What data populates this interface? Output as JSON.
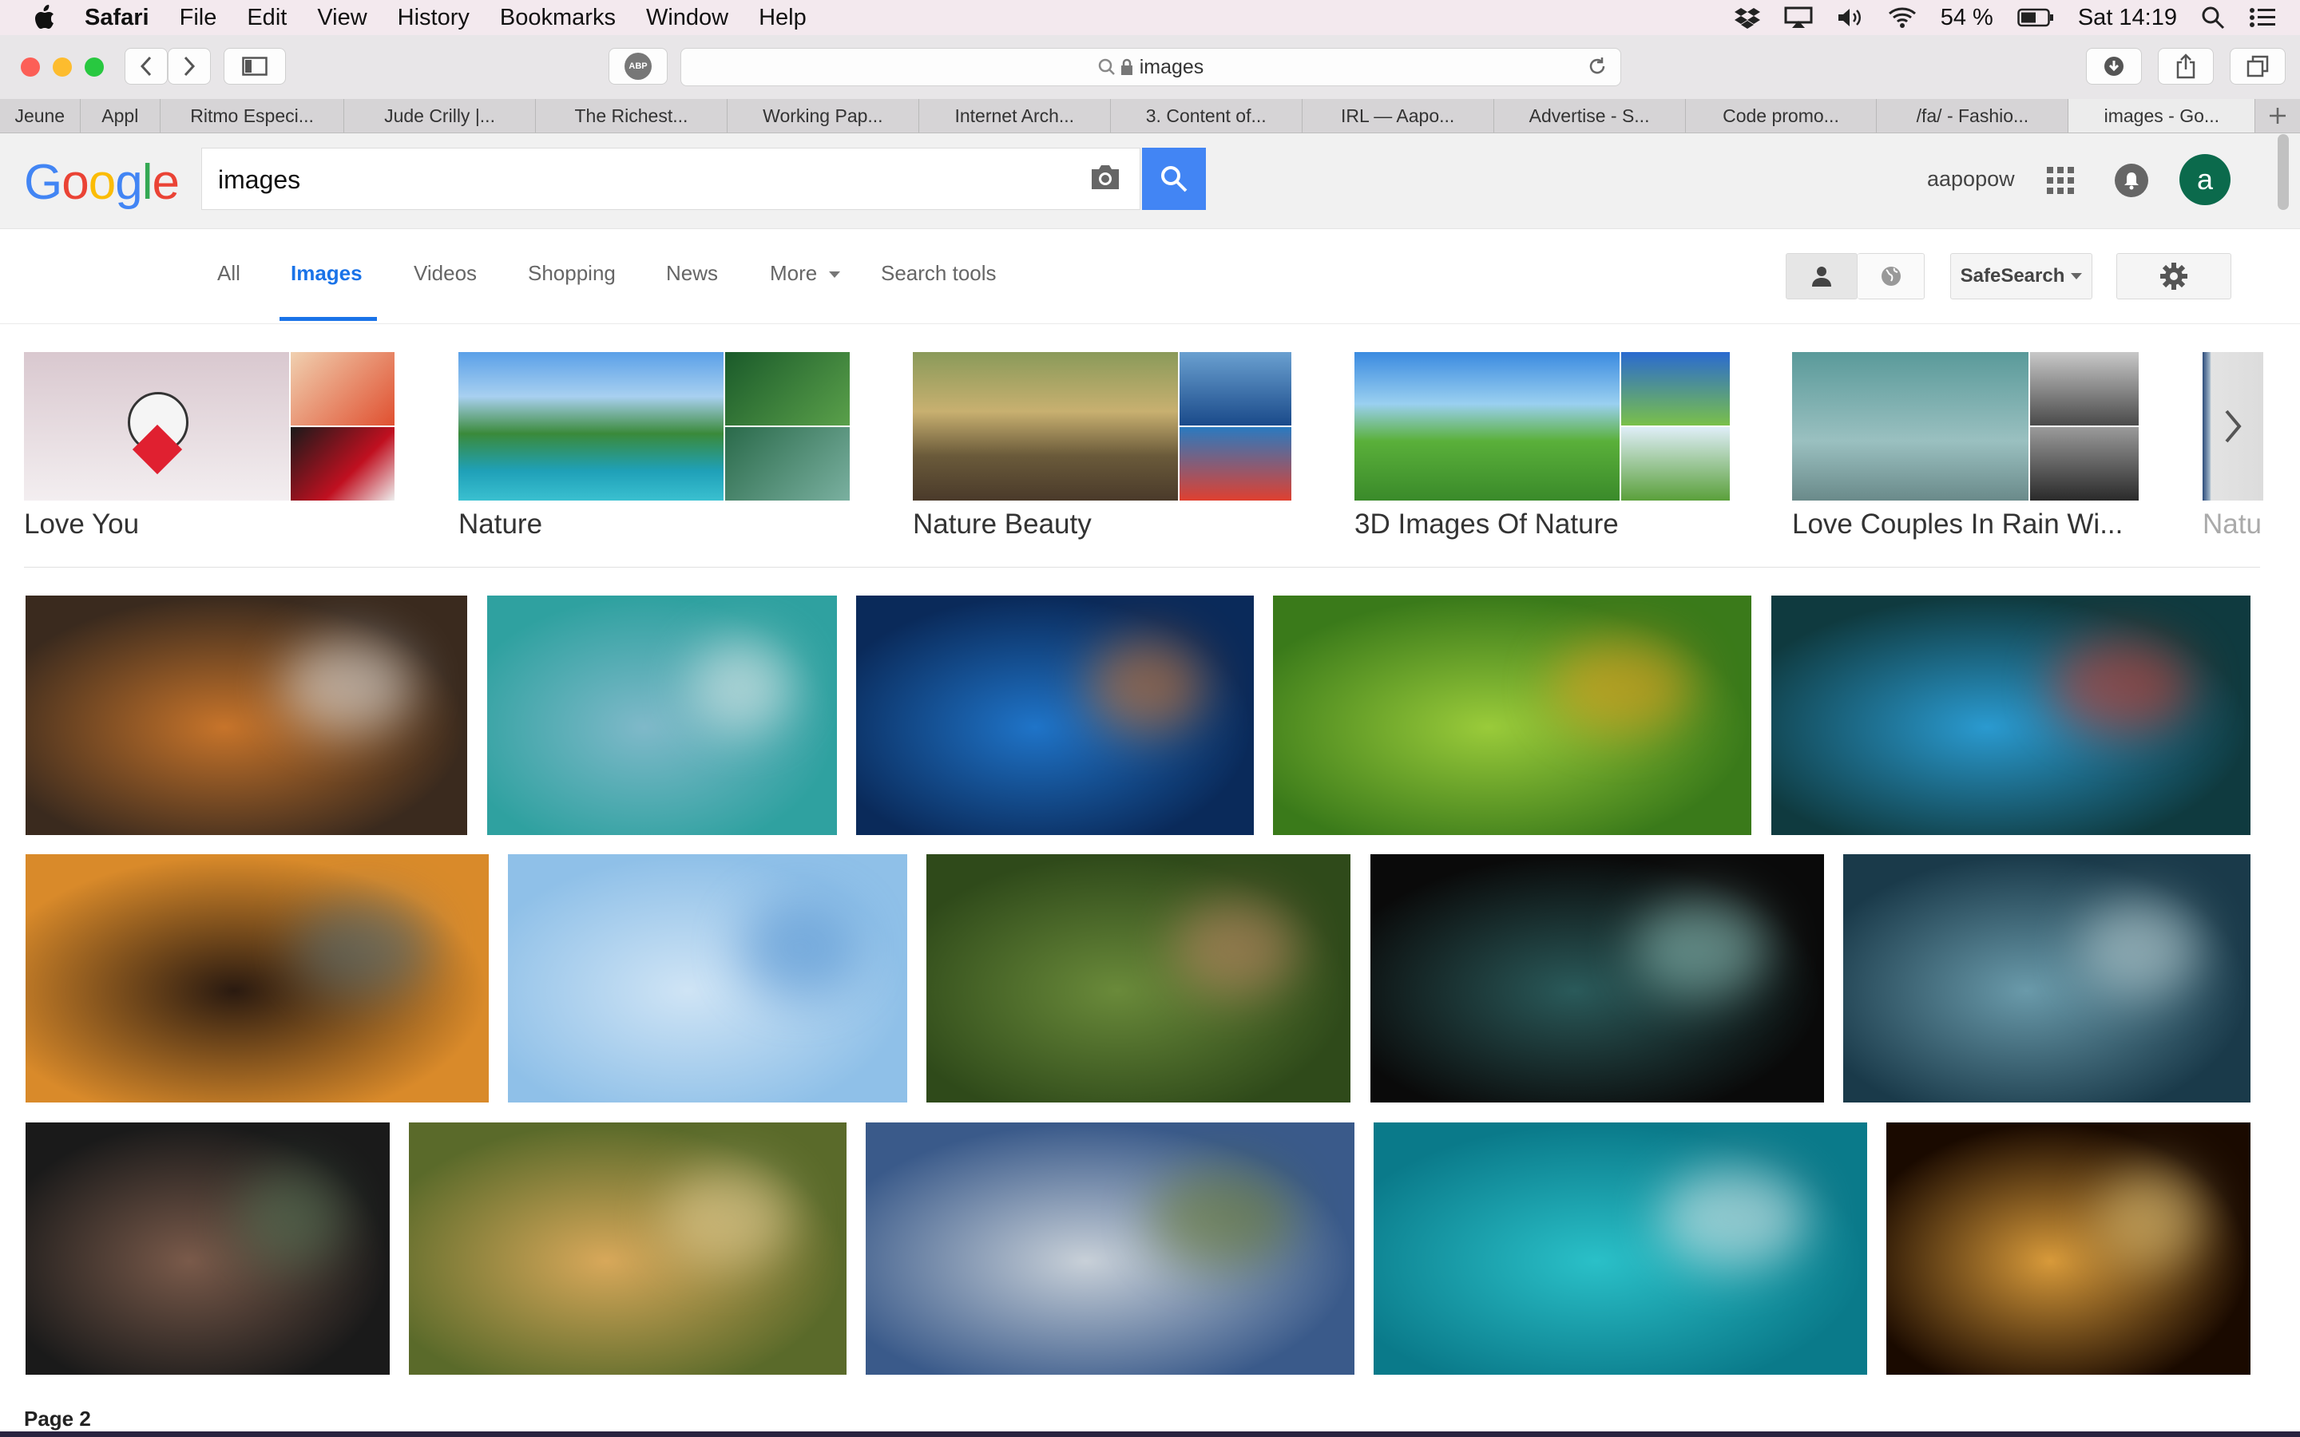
{
  "menubar": {
    "app": "Safari",
    "items": [
      "File",
      "Edit",
      "View",
      "History",
      "Bookmarks",
      "Window",
      "Help"
    ],
    "battery": "54 %",
    "clock": "Sat 14:19"
  },
  "browser": {
    "url": "images",
    "adblock": "ABP",
    "tabs": [
      "Jeune",
      "Appl",
      "Ritmo Especi...",
      "Jude Crilly |...",
      "The Richest...",
      "Working Pap...",
      "Internet Arch...",
      "3. Content of...",
      "IRL — Aapo...",
      "Advertise - S...",
      "Code promo...",
      "/fa/ - Fashio...",
      "images - Go..."
    ]
  },
  "google": {
    "query": "images",
    "user": "aapopow",
    "avatar_letter": "a",
    "tabs": [
      "All",
      "Images",
      "Videos",
      "Shopping",
      "News",
      "More",
      "Search tools"
    ],
    "active_tab": "Images",
    "safesearch": "SafeSearch"
  },
  "related": [
    "Love You",
    "Nature",
    "Nature Beauty",
    "3D Images Of Nature",
    "Love Couples In Rain Wi...",
    "Natu"
  ],
  "footer": {
    "page": "Page 2"
  },
  "results": [
    {
      "name": "tiger-in-snow",
      "colors": [
        "#3a2a1e",
        "#c7742a",
        "#eef1f3"
      ]
    },
    {
      "name": "pop-art-robots",
      "colors": [
        "#2fa1a0",
        "#7fb9c9",
        "#f0f0f0"
      ]
    },
    {
      "name": "galaxy-space",
      "colors": [
        "#0a2a5a",
        "#1f74c8",
        "#e07a2a"
      ]
    },
    {
      "name": "kingfisher-birds",
      "colors": [
        "#3a7a1a",
        "#9acb3a",
        "#f0a020"
      ]
    },
    {
      "name": "parrot-wings",
      "colors": [
        "#0f3a3f",
        "#2a9ad0",
        "#d83a2a"
      ]
    },
    {
      "name": "tiger-closeup",
      "colors": [
        "#d98a2a",
        "#2a1a10",
        "#4a6a7a"
      ]
    },
    {
      "name": "water-rose",
      "colors": [
        "#8fc0e8",
        "#cfe4f5",
        "#4f8fcf"
      ]
    },
    {
      "name": "violinist-forest",
      "colors": [
        "#2f4a1a",
        "#6a8a3a",
        "#c98a6a"
      ]
    },
    {
      "name": "cyclist-mesh",
      "colors": [
        "#0a0a0a",
        "#2a5a5a",
        "#9ad0c8"
      ]
    },
    {
      "name": "whale-shark-diver",
      "colors": [
        "#1a3a4a",
        "#6a9aaa",
        "#c8dde0"
      ]
    },
    {
      "name": "sackboy-globe",
      "colors": [
        "#1a1a1a",
        "#7a5a4a",
        "#5a7a5a"
      ]
    },
    {
      "name": "dog-bubbles",
      "colors": [
        "#5a6a2a",
        "#d8a85a",
        "#f0d8a0"
      ]
    },
    {
      "name": "tree-clouds",
      "colors": [
        "#3a5a8a",
        "#c8d0d8",
        "#6a7a2a"
      ]
    },
    {
      "name": "sailboat-sea",
      "colors": [
        "#0a7a8a",
        "#2ac0c8",
        "#f0f0f0"
      ]
    },
    {
      "name": "fractal-leopard",
      "colors": [
        "#1a0a00",
        "#d89a3a",
        "#f0d080"
      ]
    }
  ]
}
